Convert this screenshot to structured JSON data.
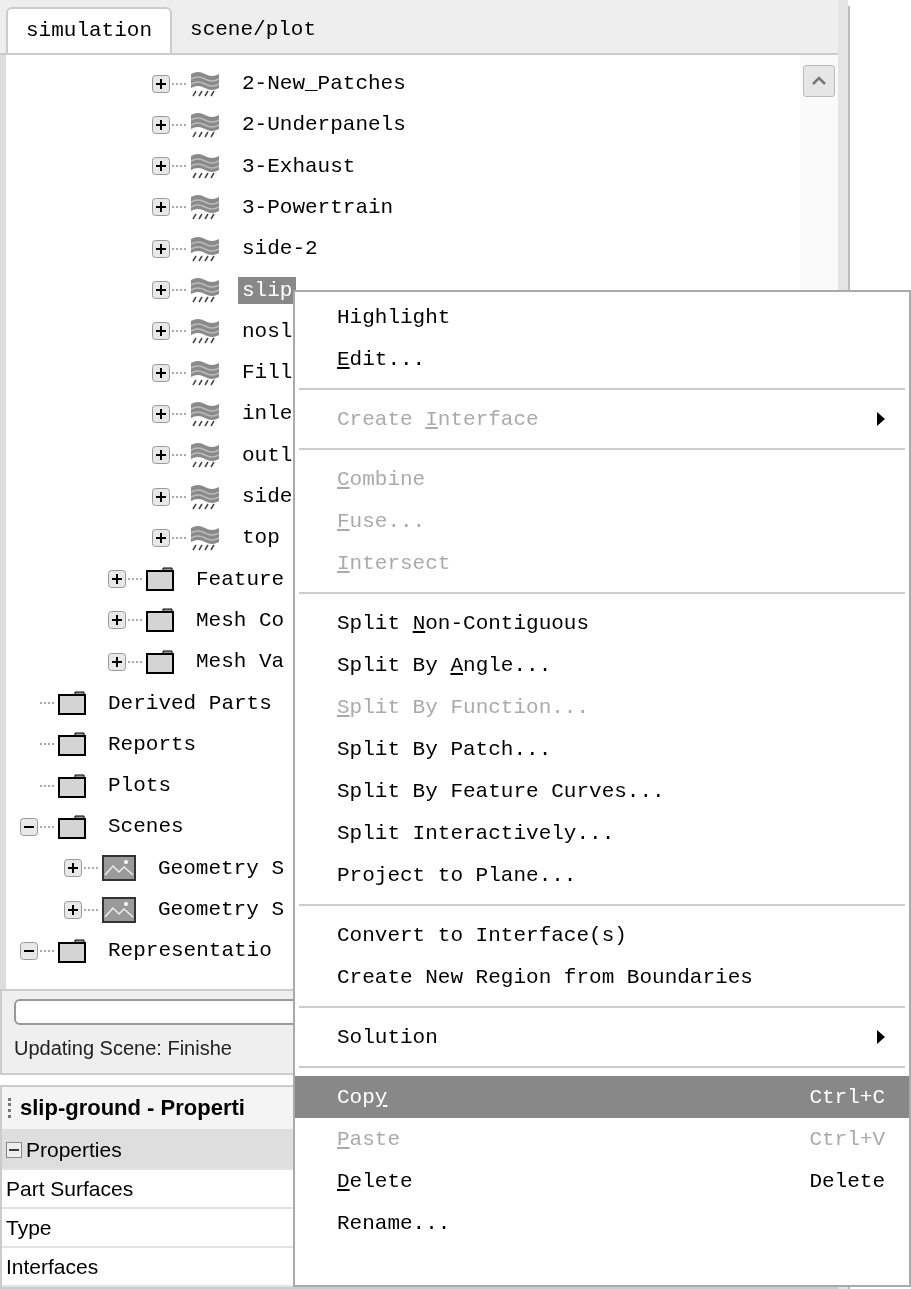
{
  "tabs": [
    {
      "label": "simulation",
      "selected": true
    },
    {
      "label": "scene/plot",
      "selected": false
    }
  ],
  "tree": [
    {
      "children": [
        {
          "children": [
            {
              "children": [
                {
                  "label": "2-New_Patches",
                  "kind": "surface",
                  "expanded": false,
                  "selected": false
                },
                {
                  "label": "2-Underpanels",
                  "kind": "surface",
                  "expanded": false,
                  "selected": false
                },
                {
                  "label": "3-Exhaust",
                  "kind": "surface",
                  "expanded": false,
                  "selected": false
                },
                {
                  "label": "3-Powertrain",
                  "kind": "surface",
                  "expanded": false,
                  "selected": false
                },
                {
                  "label": "side-2",
                  "kind": "surface",
                  "expanded": false,
                  "selected": false
                },
                {
                  "label": "slip",
                  "kind": "surface",
                  "expanded": false,
                  "selected": true
                },
                {
                  "label": "nosl",
                  "kind": "surface",
                  "expanded": false,
                  "selected": false
                },
                {
                  "label": "Fill",
                  "kind": "surface",
                  "expanded": false,
                  "selected": false
                },
                {
                  "label": "inle",
                  "kind": "surface",
                  "expanded": false,
                  "selected": false
                },
                {
                  "label": "outl",
                  "kind": "surface",
                  "expanded": false,
                  "selected": false
                },
                {
                  "label": "side",
                  "kind": "surface",
                  "expanded": false,
                  "selected": false
                },
                {
                  "label": "top",
                  "kind": "surface",
                  "expanded": false,
                  "selected": false
                }
              ]
            },
            {
              "label": "Feature",
              "kind": "folder",
              "expanded": false,
              "selected": false
            },
            {
              "label": "Mesh Co",
              "kind": "folder",
              "expanded": false,
              "selected": false
            },
            {
              "label": "Mesh Va",
              "kind": "folder",
              "expanded": false,
              "selected": false
            }
          ]
        }
      ]
    },
    {
      "label": "Derived Parts",
      "kind": "folder",
      "selected": false
    },
    {
      "label": "Reports",
      "kind": "folder",
      "selected": false
    },
    {
      "label": "Plots",
      "kind": "folder",
      "selected": false
    },
    {
      "label": "Scenes",
      "kind": "folder",
      "expanded": true,
      "selected": false,
      "children": [
        {
          "label": "Geometry S",
          "kind": "scene",
          "expanded": false,
          "selected": false
        },
        {
          "label": "Geometry S",
          "kind": "scene",
          "expanded": false,
          "selected": false
        }
      ]
    },
    {
      "label": "Representatio",
      "kind": "folder",
      "expanded": true,
      "selected": false
    }
  ],
  "status": {
    "level": 0,
    "message": "Updating Scene: Finishe"
  },
  "properties": {
    "title": "slip-ground - Properti",
    "group": {
      "label": "Properties",
      "expanded": true
    },
    "rows": [
      "Part Surfaces",
      "Type",
      "Interfaces"
    ]
  },
  "context_menu": [
    {
      "kind": "item",
      "label": "Highlight",
      "disabled": false,
      "selected": false
    },
    {
      "kind": "item",
      "key": "E",
      "after": "dit...",
      "disabled": false,
      "selected": false
    },
    {
      "kind": "separator"
    },
    {
      "kind": "item",
      "before": "Create ",
      "key": "I",
      "after": "nterface",
      "disabled": true,
      "selected": false,
      "submenu": true
    },
    {
      "kind": "separator"
    },
    {
      "kind": "item",
      "key": "C",
      "after": "ombine",
      "disabled": true,
      "selected": false
    },
    {
      "kind": "item",
      "key": "F",
      "after": "use...",
      "disabled": true,
      "selected": false
    },
    {
      "kind": "item",
      "key": "I",
      "after": "ntersect",
      "disabled": true,
      "selected": false
    },
    {
      "kind": "separator"
    },
    {
      "kind": "item",
      "before": "Split ",
      "key": "N",
      "after": "on-Contiguous",
      "disabled": false,
      "selected": false
    },
    {
      "kind": "item",
      "before": "Split By ",
      "key": "A",
      "after": "ngle...",
      "disabled": false,
      "selected": false
    },
    {
      "kind": "item",
      "key": "S",
      "after": "plit By Function...",
      "disabled": true,
      "selected": false
    },
    {
      "kind": "item",
      "label": "Split By Patch...",
      "disabled": false,
      "selected": false
    },
    {
      "kind": "item",
      "label": "Split By Feature Curves...",
      "disabled": false,
      "selected": false
    },
    {
      "kind": "item",
      "label": "Split Interactively...",
      "disabled": false,
      "selected": false
    },
    {
      "kind": "item",
      "label": "Project to Plane...",
      "disabled": false,
      "selected": false
    },
    {
      "kind": "separator"
    },
    {
      "kind": "item",
      "label": "Convert to Interface(s)",
      "disabled": false,
      "selected": false
    },
    {
      "kind": "item",
      "label": "Create New Region from Boundaries",
      "disabled": false,
      "selected": false
    },
    {
      "kind": "separator"
    },
    {
      "kind": "item",
      "label": "Solution",
      "disabled": false,
      "selected": false,
      "submenu": true
    },
    {
      "kind": "separator"
    },
    {
      "kind": "item",
      "before": "Cop",
      "key": "y",
      "shortcut": "Ctrl+C",
      "disabled": false,
      "selected": true
    },
    {
      "kind": "item",
      "key": "P",
      "after": "aste",
      "shortcut": "Ctrl+V",
      "disabled": true,
      "selected": false
    },
    {
      "kind": "item",
      "key": "D",
      "after": "elete",
      "shortcut": "Delete",
      "disabled": false,
      "selected": false
    },
    {
      "kind": "item",
      "label": "Rename...",
      "disabled": false,
      "selected": false
    }
  ]
}
